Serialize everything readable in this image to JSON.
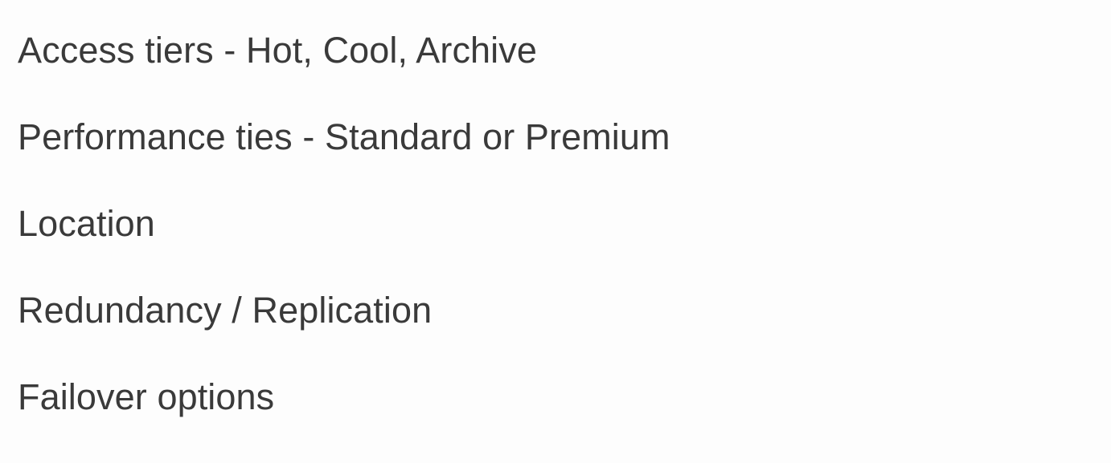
{
  "items": [
    {
      "label": "Access tiers - Hot, Cool, Archive"
    },
    {
      "label": "Performance ties - Standard or Premium"
    },
    {
      "label": "Location"
    },
    {
      "label": "Redundancy / Replication"
    },
    {
      "label": "Failover options"
    }
  ]
}
